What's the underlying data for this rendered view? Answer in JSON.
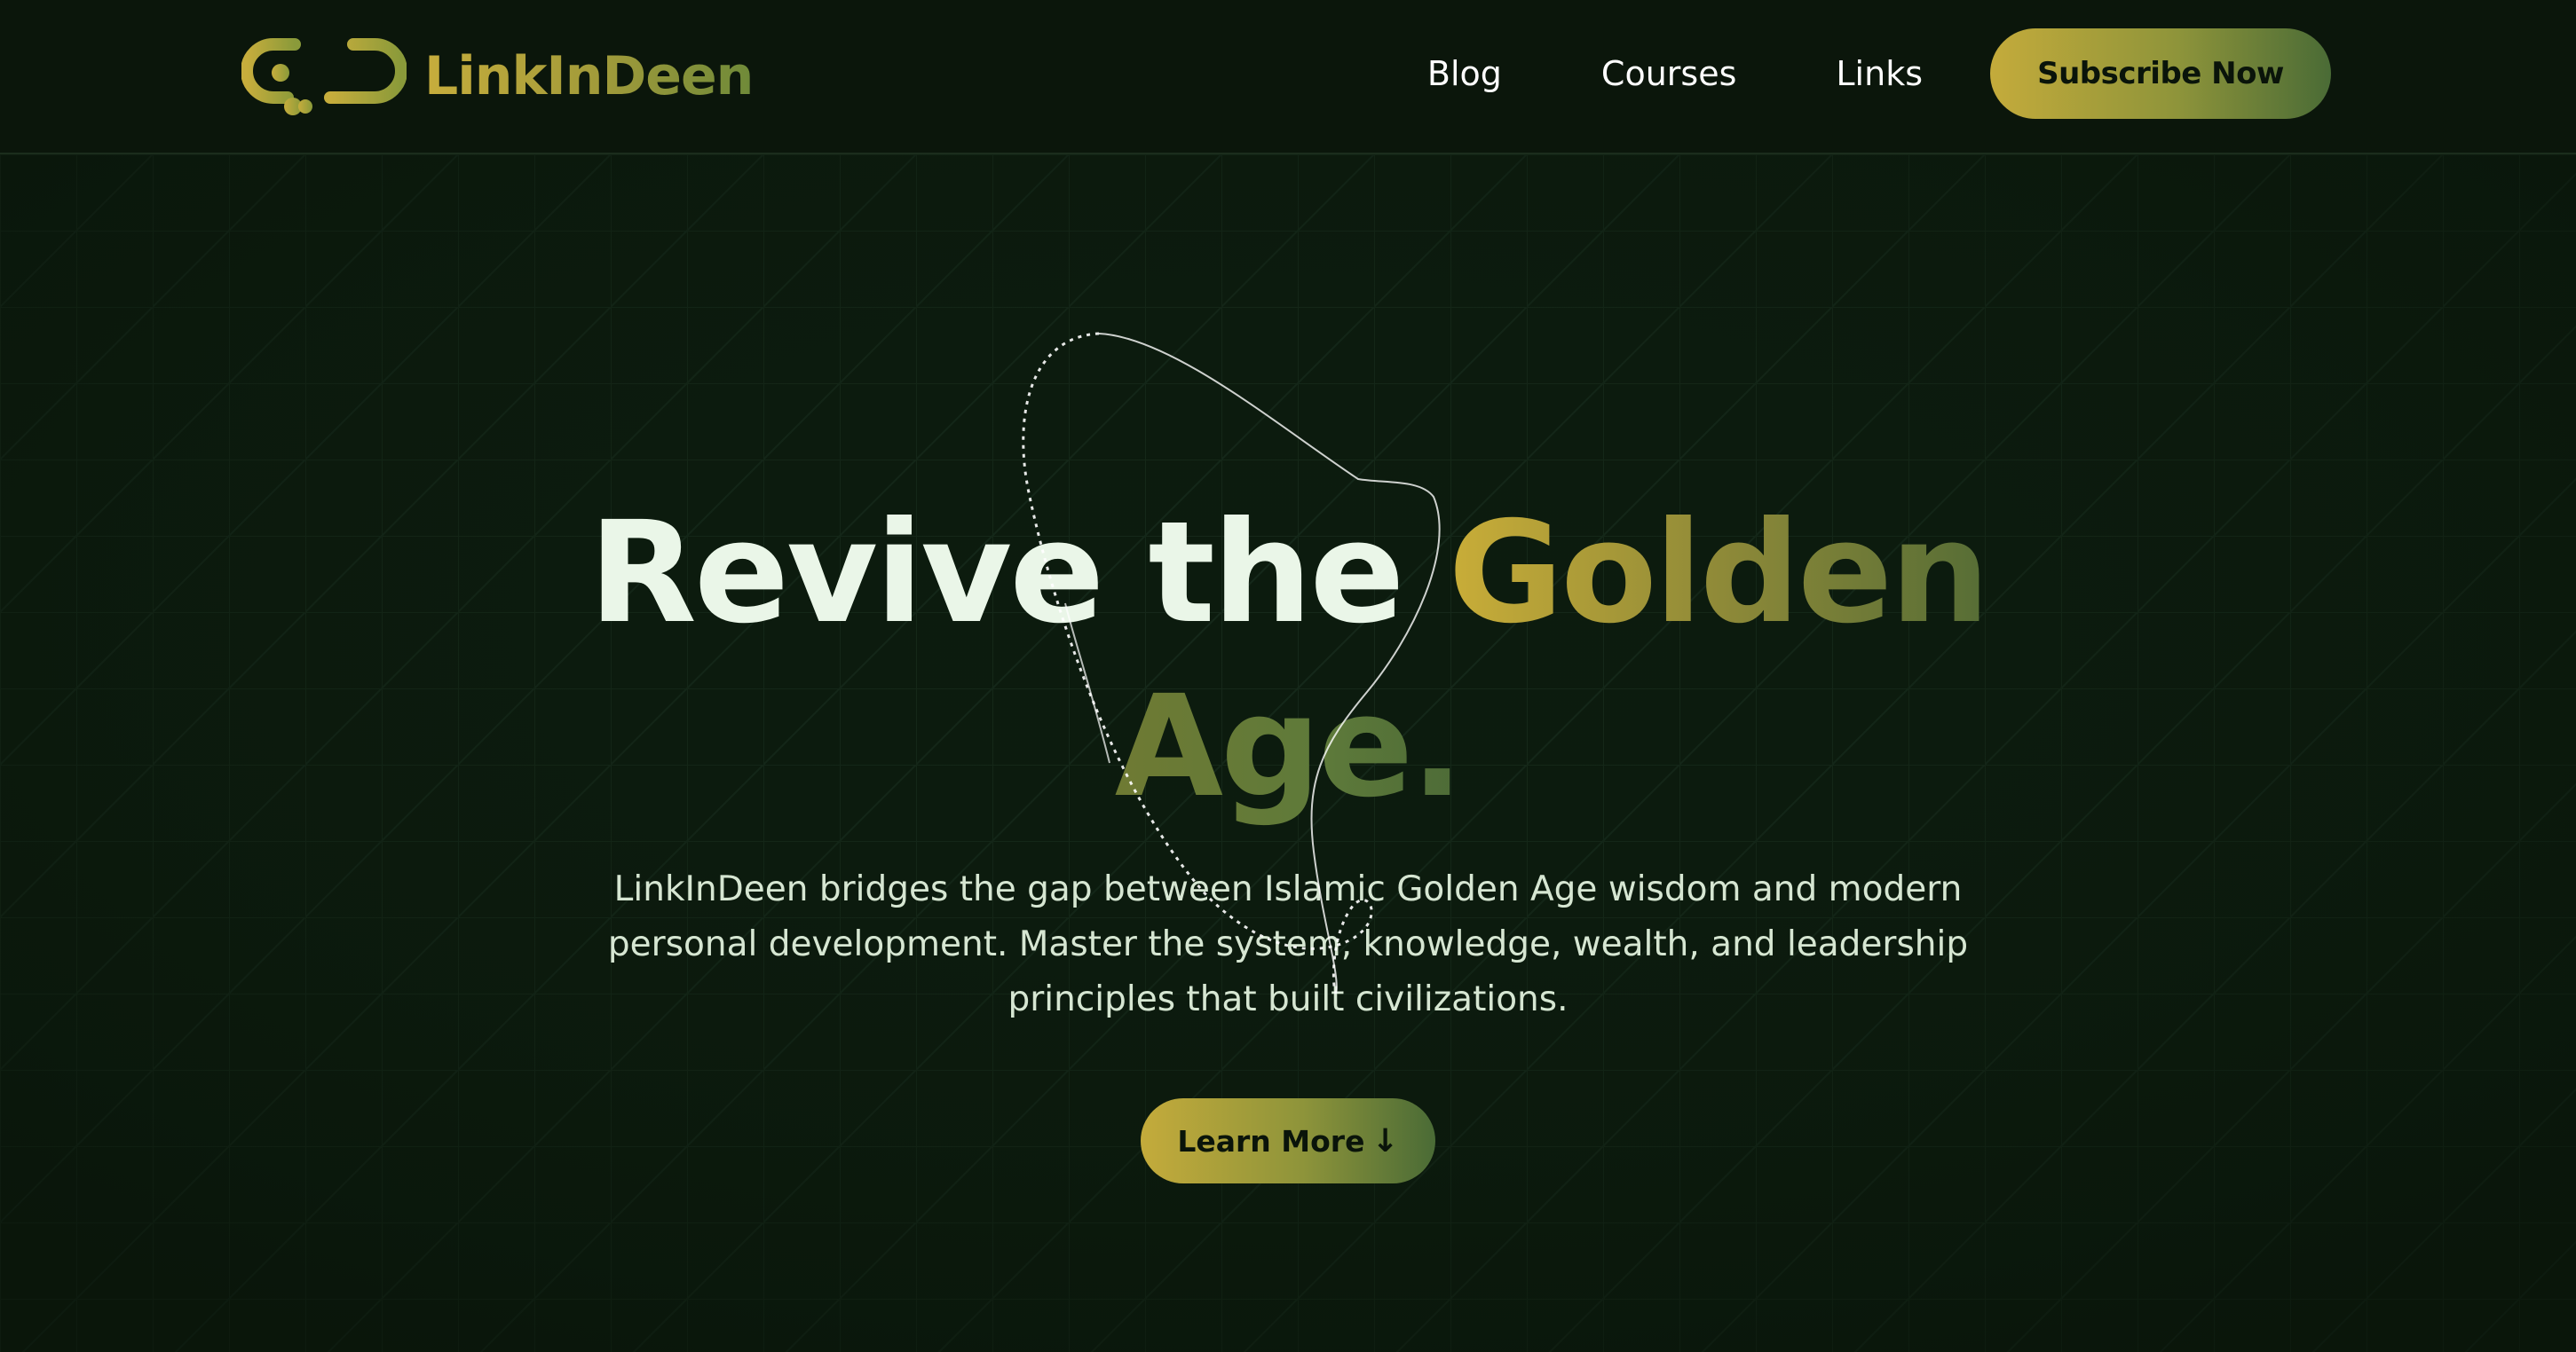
{
  "brand": {
    "name": "LinkInDeen",
    "logo_icon": "chain-link-icon"
  },
  "nav": {
    "items": [
      {
        "label": "Blog"
      },
      {
        "label": "Courses"
      },
      {
        "label": "Links"
      }
    ],
    "subscribe_label": "Subscribe Now"
  },
  "hero": {
    "title_plain": "Revive the ",
    "title_accent": "Golden",
    "title_accent_line2": "Age.",
    "description": "LinkInDeen bridges the gap between Islamic Golden Age wisdom and modern personal development. Master the system, knowledge, wealth, and leadership principles that built civilizations.",
    "cta_label": "Learn More",
    "cta_icon": "arrow-down-icon"
  },
  "colors": {
    "background": "#0b180c",
    "accent_gold": "#c9ad38",
    "accent_green": "#4d6b37",
    "text_light": "#eaf6e8"
  }
}
